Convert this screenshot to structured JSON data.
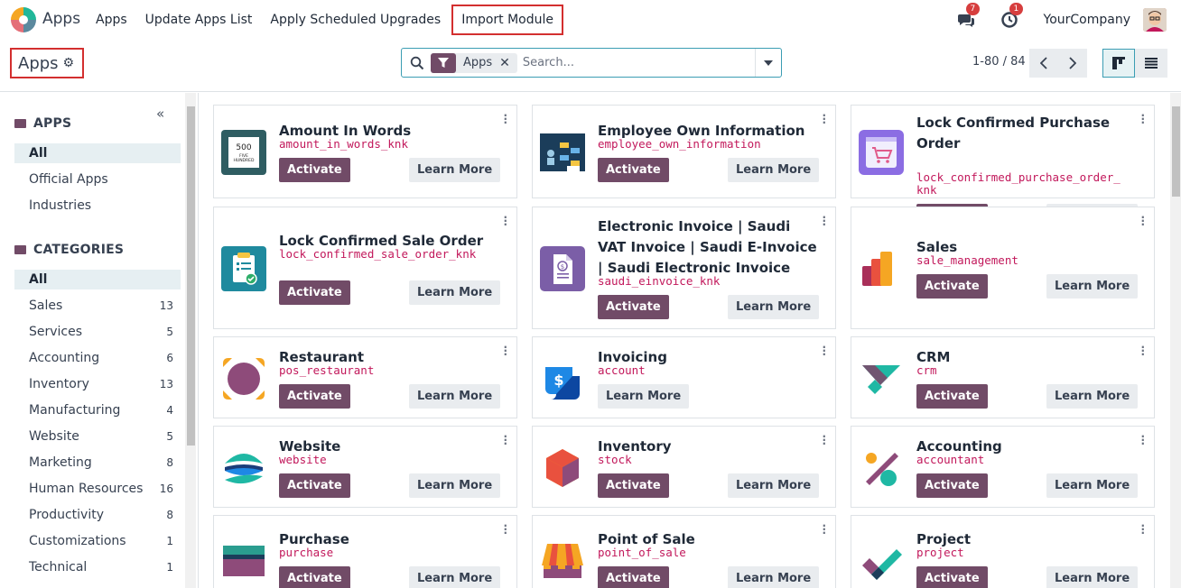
{
  "navbar": {
    "app_title": "Apps",
    "menu": [
      "Apps",
      "Update Apps List",
      "Apply Scheduled Upgrades",
      "Import Module"
    ],
    "messages_count": "7",
    "activities_count": "1",
    "company": "YourCompany"
  },
  "control_panel": {
    "breadcrumb": "Apps",
    "facet_label": "Apps",
    "search_placeholder": "Search...",
    "pager": "1-80 / 84"
  },
  "sidebar": {
    "apps_header": "APPS",
    "apps_items": [
      "All",
      "Official Apps",
      "Industries"
    ],
    "categories_header": "CATEGORIES",
    "categories": [
      {
        "label": "All",
        "count": ""
      },
      {
        "label": "Sales",
        "count": "13"
      },
      {
        "label": "Services",
        "count": "5"
      },
      {
        "label": "Accounting",
        "count": "6"
      },
      {
        "label": "Inventory",
        "count": "13"
      },
      {
        "label": "Manufacturing",
        "count": "4"
      },
      {
        "label": "Website",
        "count": "5"
      },
      {
        "label": "Marketing",
        "count": "8"
      },
      {
        "label": "Human Resources",
        "count": "16"
      },
      {
        "label": "Productivity",
        "count": "8"
      },
      {
        "label": "Customizations",
        "count": "1"
      },
      {
        "label": "Technical",
        "count": "1"
      }
    ]
  },
  "buttons": {
    "activate": "Activate",
    "learn_more": "Learn More"
  },
  "modules": [
    {
      "name": "Amount In Words",
      "tech": "amount_in_words_knk",
      "icon": "amount-in-words-icon",
      "icon_text": [
        "500",
        "FIVE",
        "HUNDRED"
      ],
      "activate": true
    },
    {
      "name": "Employee Own Information",
      "tech": "employee_own_information",
      "icon": "employee-info-icon",
      "activate": true
    },
    {
      "name": "Lock Confirmed Purchase Order",
      "tech": "lock_confirmed_purchase_order_knk",
      "icon": "lock-purchase-icon",
      "activate": true
    },
    {
      "name": "Lock Confirmed Sale Order",
      "tech": "lock_confirmed_sale_order_knk",
      "icon": "lock-sale-icon",
      "activate": true
    },
    {
      "name": "Electronic Invoice | Saudi VAT Invoice | Saudi E-Invoice | Saudi Electronic Invoice",
      "tech": "saudi_einvoice_knk",
      "icon": "einvoice-icon",
      "activate": true
    },
    {
      "name": "Sales",
      "tech": "sale_management",
      "icon": "sales-icon",
      "activate": true
    },
    {
      "name": "Restaurant",
      "tech": "pos_restaurant",
      "icon": "restaurant-icon",
      "activate": true
    },
    {
      "name": "Invoicing",
      "tech": "account",
      "icon": "invoicing-icon",
      "activate": false
    },
    {
      "name": "CRM",
      "tech": "crm",
      "icon": "crm-icon",
      "activate": true
    },
    {
      "name": "Website",
      "tech": "website",
      "icon": "website-icon",
      "activate": true
    },
    {
      "name": "Inventory",
      "tech": "stock",
      "icon": "inventory-icon",
      "activate": true
    },
    {
      "name": "Accounting",
      "tech": "accountant",
      "icon": "accounting-icon",
      "activate": true
    },
    {
      "name": "Purchase",
      "tech": "purchase",
      "icon": "purchase-icon",
      "activate": true
    },
    {
      "name": "Point of Sale",
      "tech": "point_of_sale",
      "icon": "point-of-sale-icon",
      "activate": true
    },
    {
      "name": "Project",
      "tech": "project",
      "icon": "project-icon",
      "activate": true
    }
  ],
  "colors": {
    "primary": "#714b67",
    "accent": "#3b9db3",
    "tech_name": "#c2185b",
    "highlight_border": "#d32f2f"
  }
}
